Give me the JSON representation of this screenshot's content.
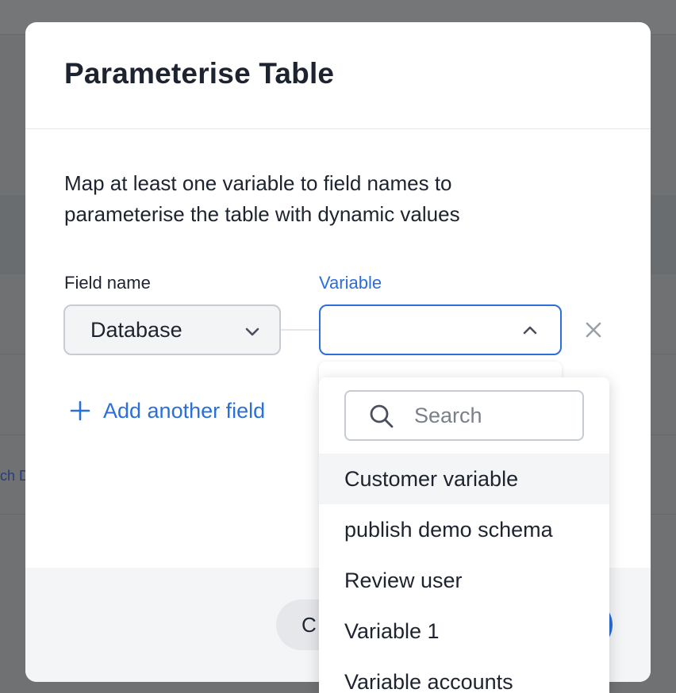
{
  "background": {
    "link_fragment": "ch D"
  },
  "modal": {
    "title": "Parameterise Table",
    "description": "Map at least one variable to field names to parameterise the table with dynamic values",
    "field_label": "Field name",
    "variable_label": "Variable",
    "field_value": "Database",
    "variable_value": "",
    "add_field_label": "Add another field",
    "cancel_label": "C"
  },
  "dropdown": {
    "search_placeholder": "Search",
    "options": [
      "Customer variable",
      "publish demo schema",
      "Review user",
      "Variable 1",
      "Variable accounts"
    ],
    "hovered_option": "Customer variable"
  },
  "colors": {
    "accent": "#2a6fdb",
    "text": "#1d232f",
    "overlay": "#6f7173",
    "footer": "#f4f5f7"
  },
  "icons": {
    "field_chevron": "chevron-down-icon",
    "variable_chevron": "chevron-up-icon",
    "remove": "close-icon",
    "add": "plus-icon",
    "search": "search-icon"
  }
}
